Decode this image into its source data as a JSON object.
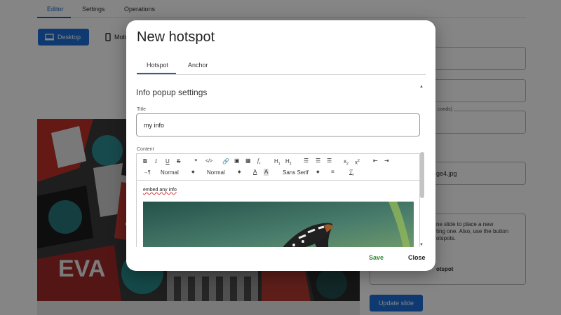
{
  "colors": {
    "primary": "#1e6fd9",
    "save": "#2e8b2e"
  },
  "top_tabs": [
    {
      "label": "Editor"
    },
    {
      "label": "Settings"
    },
    {
      "label": "Operations"
    }
  ],
  "view_modes": {
    "desktop": "Desktop",
    "mobile": "Mob"
  },
  "background": {
    "field_partial_label": "conds)",
    "image_field_value": "ge4.jpg",
    "help_lines": [
      "ne slide to place a new",
      "ting one. Also, use the button",
      "otspots."
    ],
    "help_partial_button": "otspot",
    "update_button": "Update slide"
  },
  "modal": {
    "title": "New hotspot",
    "tabs": [
      {
        "label": "Hotspot"
      },
      {
        "label": "Anchor"
      }
    ],
    "section_title": "Info popup settings",
    "title_label": "Title",
    "title_value": "my info",
    "content_label": "Content",
    "toolbar": {
      "header_select": "Normal",
      "size_select": "Normal",
      "font_select": "Sans Serif"
    },
    "content_text": "embed any info",
    "save_label": "Save",
    "close_label": "Close"
  }
}
